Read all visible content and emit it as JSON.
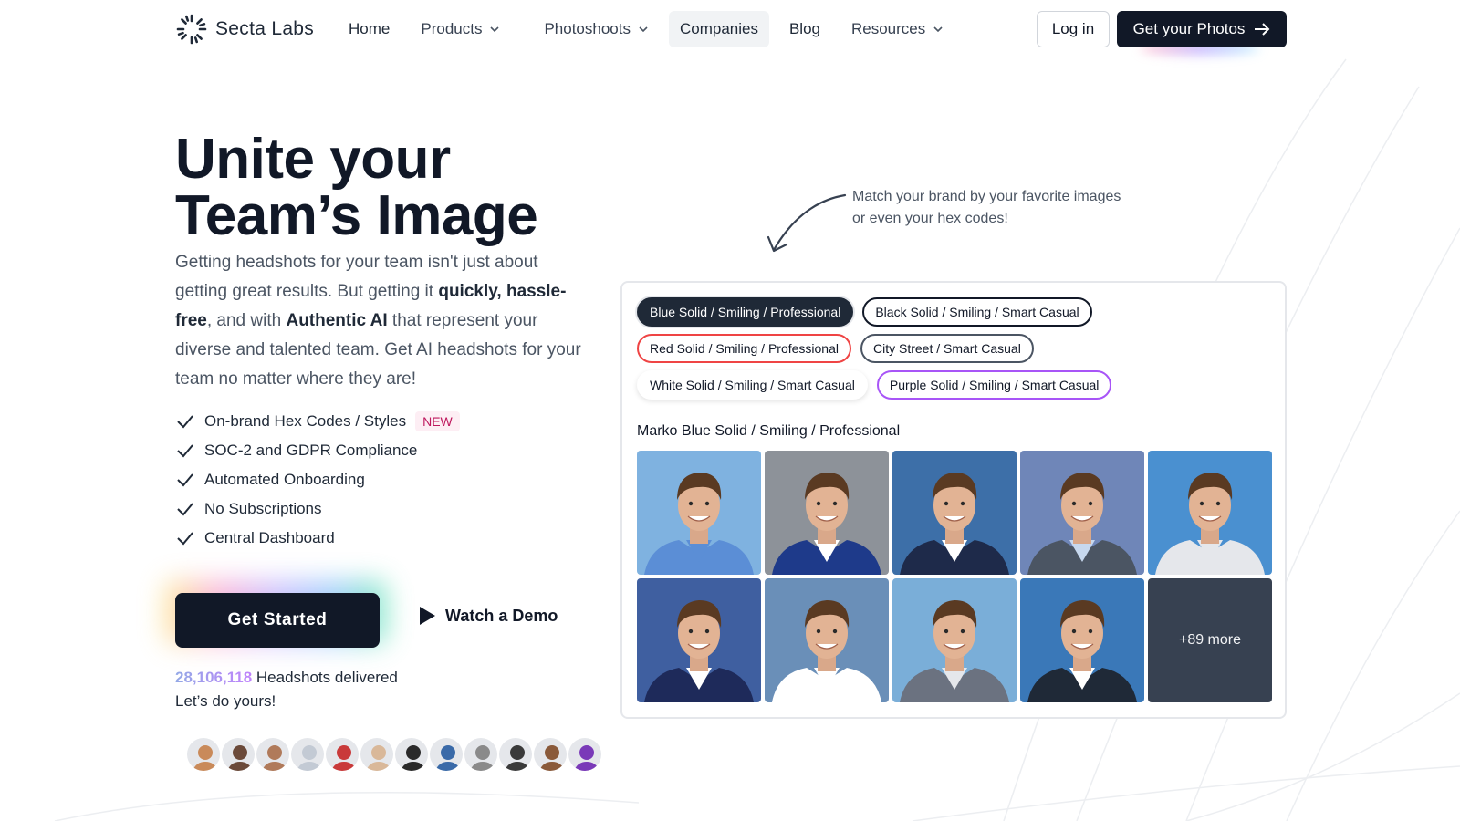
{
  "nav": {
    "logo_text": "Secta Labs",
    "links": [
      {
        "label": "Home"
      },
      {
        "label": "Products"
      },
      {
        "label": "Photoshoots"
      },
      {
        "label": "Companies"
      },
      {
        "label": "Blog"
      },
      {
        "label": "Resources"
      }
    ],
    "login_label": "Log in",
    "cta_label": "Get your Photos"
  },
  "hero": {
    "title_line1": "Unite your",
    "title_line2": "Team’s Image",
    "desc_part1": "Getting headshots for your team isn't just about getting great results. But getting it ",
    "desc_bold1": "quickly, hassle-free",
    "desc_part2": ", and with ",
    "desc_bold2": "Authentic AI",
    "desc_part3": " that represent your diverse and talented team. Get AI headshots for your team no matter where they are!",
    "features": [
      {
        "label": "On-brand Hex Codes / Styles",
        "badge": "NEW"
      },
      {
        "label": "SOC-2 and GDPR Compliance"
      },
      {
        "label": "Automated Onboarding"
      },
      {
        "label": "No Subscriptions"
      },
      {
        "label": "Central Dashboard"
      }
    ],
    "cta_label": "Get Started",
    "demo_label": "Watch a Demo",
    "stats_count": "28,106,118",
    "stats_suffix": " Headshots delivered",
    "stats_line2": "Let’s do yours!"
  },
  "annotation": {
    "line1": "Match your brand by your favorite images",
    "line2": "or even your hex codes!"
  },
  "panel": {
    "chips": [
      [
        {
          "label": "Blue Solid / Smiling / Professional",
          "style": "selected"
        },
        {
          "label": "Black Solid / Smiling / Smart Casual",
          "style": "black"
        }
      ],
      [
        {
          "label": "Red Solid / Smiling / Professional",
          "style": "red"
        },
        {
          "label": "City Street / Smart Casual",
          "style": "grey"
        }
      ],
      [
        {
          "label": "White Solid / Smiling / Smart Casual",
          "style": "white"
        },
        {
          "label": "Purple Solid / Smiling / Smart Casual",
          "style": "purple"
        }
      ]
    ],
    "grid_title": "Marko Blue Solid / Smiling / Professional",
    "photos": [
      {
        "bg": "#7fb2e0",
        "suit": "#5b8ed6",
        "shirt": "#5b8ed6"
      },
      {
        "bg": "#8d9299",
        "suit": "#1e3a8a",
        "shirt": "#ffffff"
      },
      {
        "bg": "#3d6fa8",
        "suit": "#1e2a4a",
        "shirt": "#ffffff"
      },
      {
        "bg": "#6f86b8",
        "suit": "#4b5563",
        "shirt": "#c7d8ee"
      },
      {
        "bg": "#4a90d0",
        "suit": "#e5e7eb",
        "shirt": "#e5e7eb"
      },
      {
        "bg": "#3f5fa0",
        "suit": "#1e2a5a",
        "shirt": "#ffffff"
      },
      {
        "bg": "#6a8fb8",
        "suit": "#ffffff",
        "shirt": "#ffffff"
      },
      {
        "bg": "#7aaed8",
        "suit": "#6b7280",
        "shirt": "#e5e7eb"
      },
      {
        "bg": "#3a78b8",
        "suit": "#1f2937",
        "shirt": "#ffffff"
      }
    ],
    "more_label": "+89 more"
  },
  "avatar_colors": [
    "#c98a5a",
    "#6b4a3a",
    "#b07a5a",
    "#c3cad4",
    "#c93a3a",
    "#d9b899",
    "#2a2a2a",
    "#3a6aa8",
    "#8a8a8a",
    "#3a3a3a",
    "#8a5a3a",
    "#7a3ab8"
  ]
}
